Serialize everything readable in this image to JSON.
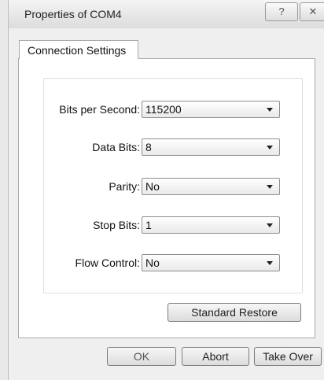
{
  "window": {
    "title": "Properties of COM4",
    "help_glyph": "?",
    "close_glyph": "✕"
  },
  "tabs": [
    {
      "label": "Connection Settings"
    }
  ],
  "fields": [
    {
      "label": "Bits per Second:",
      "value": "115200"
    },
    {
      "label": "Data Bits:",
      "value": "8"
    },
    {
      "label": "Parity:",
      "value": "No"
    },
    {
      "label": "Stop Bits:",
      "value": "1"
    },
    {
      "label": "Flow Control:",
      "value": "No"
    }
  ],
  "buttons": {
    "restore": "Standard Restore",
    "ok": "OK",
    "abort": "Abort",
    "take_over": "Take Over"
  },
  "icons": {
    "help": "help-icon",
    "close": "close-icon",
    "dropdown": "chevron-down-icon"
  }
}
